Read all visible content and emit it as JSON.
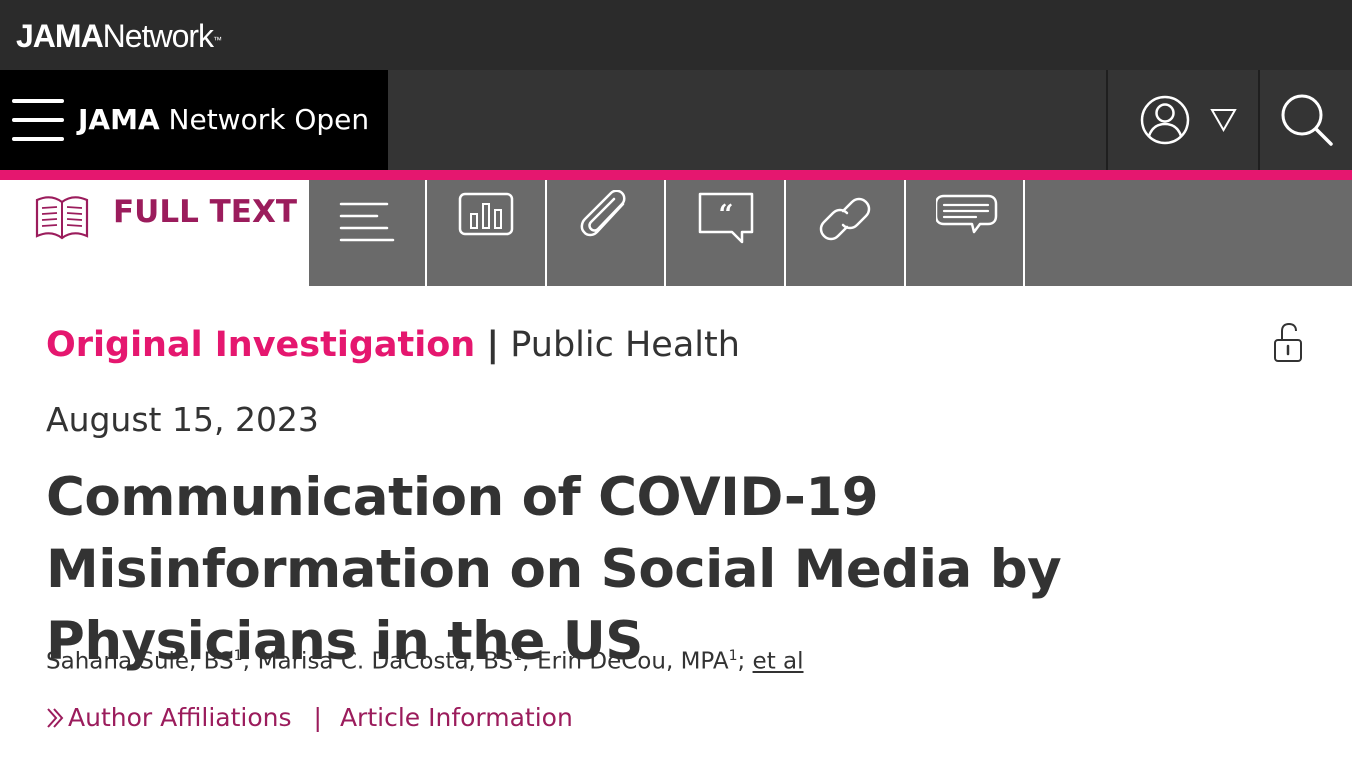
{
  "header": {
    "brand_bold": "JAMA",
    "brand_rest": "Network",
    "brand_tm": "™",
    "journal_bold": "JAMA",
    "journal_rest": "Network Open"
  },
  "tabs": {
    "full_text_label": "FULL TEXT",
    "icons": [
      "outline-icon",
      "figures-icon",
      "attachment-icon",
      "quote-icon",
      "link-icon",
      "comments-icon"
    ]
  },
  "article": {
    "category_primary": "Original Investigation",
    "category_separator": "|",
    "category_secondary": "Public Health",
    "date": "August 15, 2023",
    "title": "Communication of COVID-19 Misinformation on Social Media by Physicians in the US",
    "authors": [
      {
        "name": "Sahana Sule, BS",
        "aff": "1"
      },
      {
        "name": "Marisa C. DaCosta, BS",
        "aff": "1"
      },
      {
        "name": "Erin DeCou, MPA",
        "aff": "1"
      }
    ],
    "et_al": "et al",
    "author_affiliations": "Author Affiliations",
    "links_separator": "|",
    "article_information": "Article Information"
  },
  "colors": {
    "accent_pink": "#e5176f",
    "accent_purple": "#9b1c5c",
    "topbar": "#2b2b2b",
    "navbar": "#343434",
    "tabs_bg": "#6a6a6a"
  }
}
